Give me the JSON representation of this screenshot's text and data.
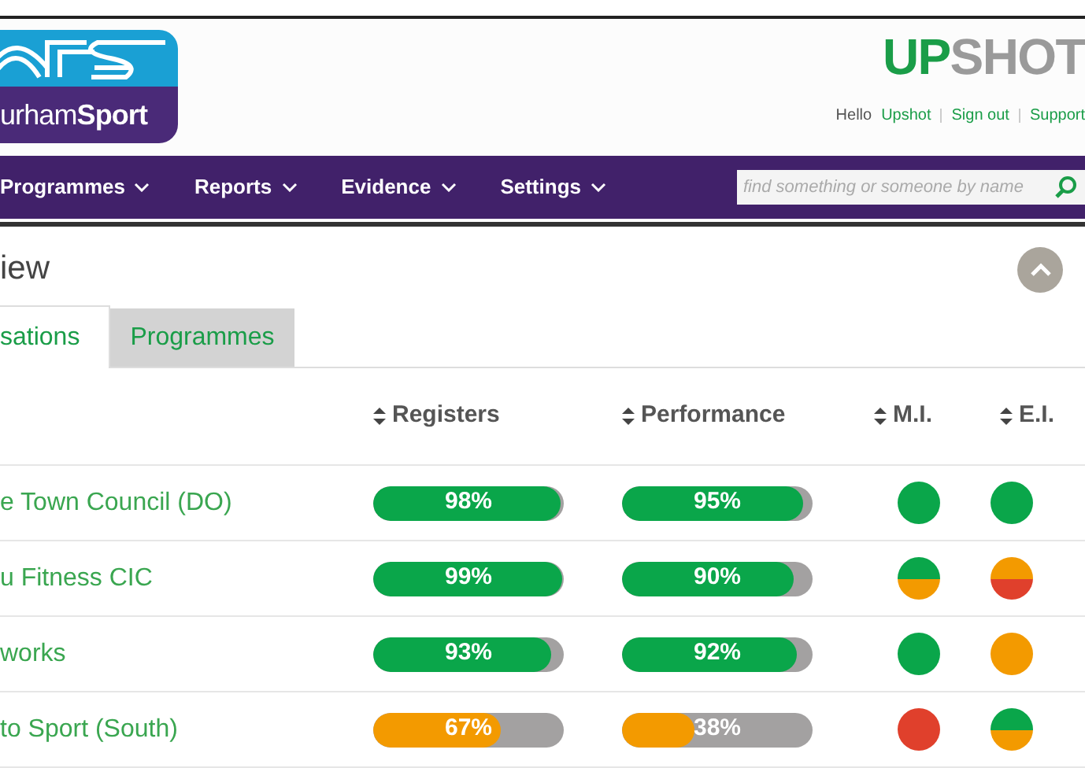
{
  "logo": {
    "text": "urham**Sport**"
  },
  "brand": {
    "part_1": "UP",
    "part_2": "SHOT"
  },
  "user_links": {
    "greeting": "Hello",
    "links": [
      "Upshot",
      "Sign out",
      "Support"
    ]
  },
  "nav": {
    "items": [
      "Programmes",
      "Reports",
      "Evidence",
      "Settings"
    ],
    "search": {
      "placeholder": "find something or someone by name"
    }
  },
  "page": {
    "title": "iew"
  },
  "tabs": [
    {
      "label": "sations",
      "selected": true
    },
    {
      "label": "Programmes",
      "selected": false
    }
  ],
  "table": {
    "columns": [
      "Registers",
      "Performance",
      "M.I.",
      "E.I."
    ],
    "rows": [
      {
        "name": "e Town Council (DO)",
        "registers": {
          "text": "98%",
          "level": 0.98,
          "color": "#0aa64a"
        },
        "performance": {
          "text": "95%",
          "level": 0.95,
          "color": "#0aa64a"
        },
        "mi": {
          "kind": "solid",
          "color": "#0aa64a"
        },
        "ei": {
          "kind": "solid",
          "color": "#0aa64a"
        }
      },
      {
        "name": "u Fitness CIC",
        "registers": {
          "text": "99%",
          "level": 0.99,
          "color": "#0aa64a"
        },
        "performance": {
          "text": "90%",
          "level": 0.9,
          "color": "#0aa64a"
        },
        "mi": {
          "kind": "split",
          "segments": [
            {
              "color": "#0aa64a"
            },
            {
              "color": "#f39a00"
            }
          ]
        },
        "ei": {
          "kind": "split",
          "segments": [
            {
              "color": "#f39a00"
            },
            {
              "color": "#e0402c"
            }
          ]
        }
      },
      {
        "name": "works",
        "registers": {
          "text": "93%",
          "level": 0.93,
          "color": "#0aa64a"
        },
        "performance": {
          "text": "92%",
          "level": 0.92,
          "color": "#0aa64a"
        },
        "mi": {
          "kind": "solid",
          "color": "#0aa64a"
        },
        "ei": {
          "kind": "solid",
          "color": "#f39a00"
        }
      },
      {
        "name": "to Sport (South)",
        "registers": {
          "text": "67%",
          "level": 0.67,
          "color": "#f39a00"
        },
        "performance": {
          "text": "38%",
          "level": 0.38,
          "color": "#f39a00"
        },
        "mi": {
          "kind": "solid",
          "color": "#e0402c"
        },
        "ei": {
          "kind": "split",
          "segments": [
            {
              "color": "#0aa64a"
            },
            {
              "color": "#f39a00"
            }
          ]
        }
      }
    ]
  }
}
